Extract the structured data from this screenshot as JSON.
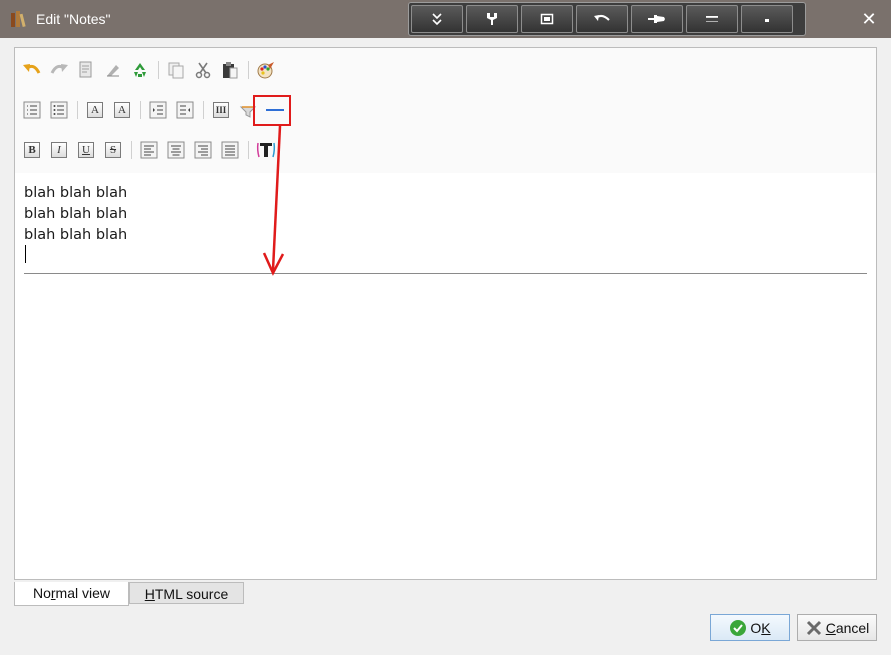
{
  "window": {
    "title": "Edit \"Notes\"",
    "close_label": "✕"
  },
  "content": {
    "lines": [
      "blah blah blah",
      "blah blah blah",
      "blah blah blah"
    ]
  },
  "tabs": [
    {
      "label": "Normal view",
      "accel": "r",
      "active": true
    },
    {
      "label": "HTML source",
      "accel": "H",
      "active": false
    }
  ],
  "buttons": {
    "ok": {
      "label": "OK",
      "accel": "K"
    },
    "cancel": {
      "label": "Cancel",
      "accel": "C"
    }
  },
  "toolbar": {
    "row2_text_icons": {
      "sup": "A",
      "sub": "A",
      "columns": "III"
    },
    "row3_format_letters": {
      "bold": "B",
      "italic": "I",
      "underline": "U",
      "strike": "S"
    }
  },
  "colors": {
    "title_bar": "#7a716c",
    "annotation": "#e01b1b",
    "hr_button_line": "#2e6fd6",
    "ok_icon": "#3aa63a",
    "cancel_icon": "#6a6a6a"
  }
}
